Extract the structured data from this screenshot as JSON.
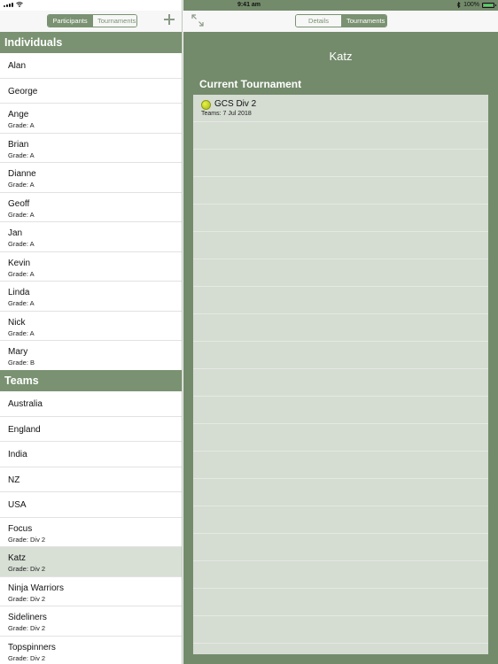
{
  "status": {
    "time": "9:41 am",
    "battery": "100%"
  },
  "master": {
    "segments": [
      {
        "label": "Participants",
        "active": true
      },
      {
        "label": "Tournaments",
        "active": false
      }
    ],
    "individuals_header": "Individuals",
    "individuals": [
      {
        "name": "Alan",
        "grade": ""
      },
      {
        "name": "George",
        "grade": ""
      },
      {
        "name": "Ange",
        "grade": "Grade: A"
      },
      {
        "name": "Brian",
        "grade": "Grade: A"
      },
      {
        "name": "Dianne",
        "grade": "Grade: A"
      },
      {
        "name": "Geoff",
        "grade": "Grade: A"
      },
      {
        "name": "Jan",
        "grade": "Grade: A"
      },
      {
        "name": "Kevin",
        "grade": "Grade: A"
      },
      {
        "name": "Linda",
        "grade": "Grade: A"
      },
      {
        "name": "Nick",
        "grade": "Grade: A"
      },
      {
        "name": "Mary",
        "grade": "Grade: B"
      }
    ],
    "teams_header": "Teams",
    "teams": [
      {
        "name": "Australia",
        "grade": ""
      },
      {
        "name": "England",
        "grade": ""
      },
      {
        "name": "India",
        "grade": ""
      },
      {
        "name": "NZ",
        "grade": ""
      },
      {
        "name": "USA",
        "grade": ""
      },
      {
        "name": "Focus",
        "grade": "Grade: Div 2"
      },
      {
        "name": "Katz",
        "grade": "Grade: Div 2",
        "selected": true
      },
      {
        "name": "Ninja Warriors",
        "grade": "Grade: Div 2"
      },
      {
        "name": "Sideliners",
        "grade": "Grade: Div 2"
      },
      {
        "name": "Topspinners",
        "grade": "Grade: Div 2"
      }
    ]
  },
  "detail": {
    "segments": [
      {
        "label": "Details",
        "active": false
      },
      {
        "label": "Tournaments",
        "active": true
      }
    ],
    "title": "Katz",
    "current_label": "Current Tournament",
    "tournament": {
      "name": "GCS Div 2",
      "subtitle": "Teams: 7 Jul 2018"
    }
  },
  "colors": {
    "accent": "#7a9271",
    "detail_bg": "#738b6b",
    "selected_row": "#d8e0d6"
  }
}
